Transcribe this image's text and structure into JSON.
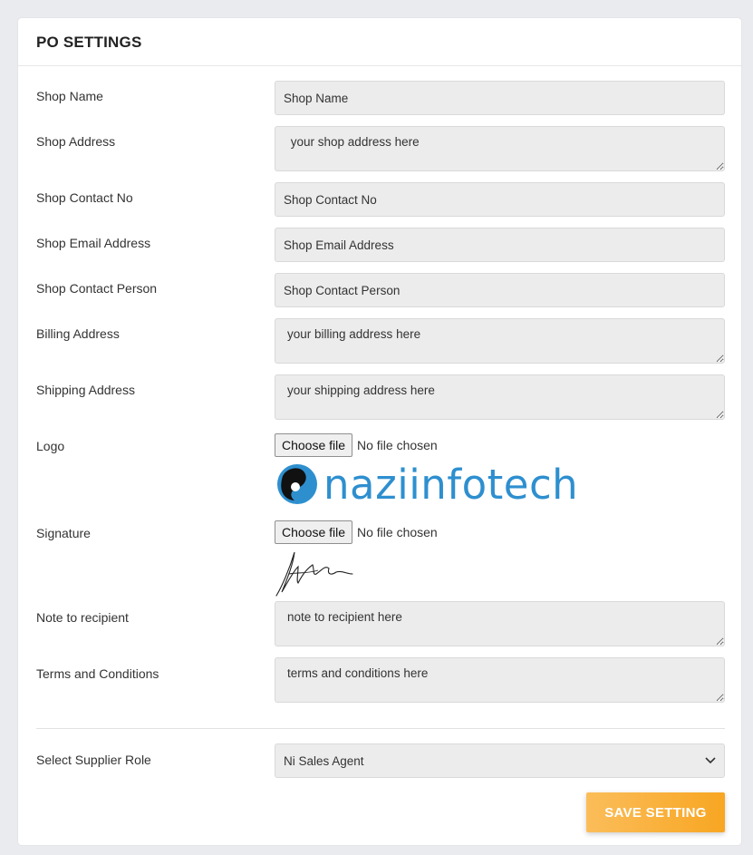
{
  "header": {
    "title": "PO SETTINGS"
  },
  "fields": {
    "shop_name": {
      "label": "Shop Name",
      "placeholder": "Shop Name"
    },
    "shop_address": {
      "label": "Shop Address",
      "placeholder": " your shop address here"
    },
    "shop_contact_no": {
      "label": "Shop Contact No",
      "placeholder": "Shop Contact No"
    },
    "shop_email": {
      "label": "Shop Email Address",
      "placeholder": "Shop Email Address"
    },
    "shop_contact_person": {
      "label": "Shop Contact Person",
      "placeholder": "Shop Contact Person"
    },
    "billing_address": {
      "label": "Billing Address",
      "placeholder": "your billing address here"
    },
    "shipping_address": {
      "label": "Shipping Address",
      "placeholder": "your shipping address here"
    },
    "logo": {
      "label": "Logo",
      "button": "Choose file",
      "status": "No file chosen",
      "preview_text": "naziinfotech"
    },
    "signature": {
      "label": "Signature",
      "button": "Choose file",
      "status": "No file chosen"
    },
    "note": {
      "label": "Note to recipient",
      "placeholder": "note to recipient here"
    },
    "terms": {
      "label": "Terms and Conditions",
      "placeholder": "terms and conditions here"
    },
    "supplier_role": {
      "label": "Select Supplier Role",
      "value": "Ni Sales Agent"
    }
  },
  "actions": {
    "save_label": "SAVE SETTING"
  },
  "colors": {
    "accent": "#f8a622",
    "logo_blue": "#2e8fcf",
    "field_bg": "#ececec"
  }
}
